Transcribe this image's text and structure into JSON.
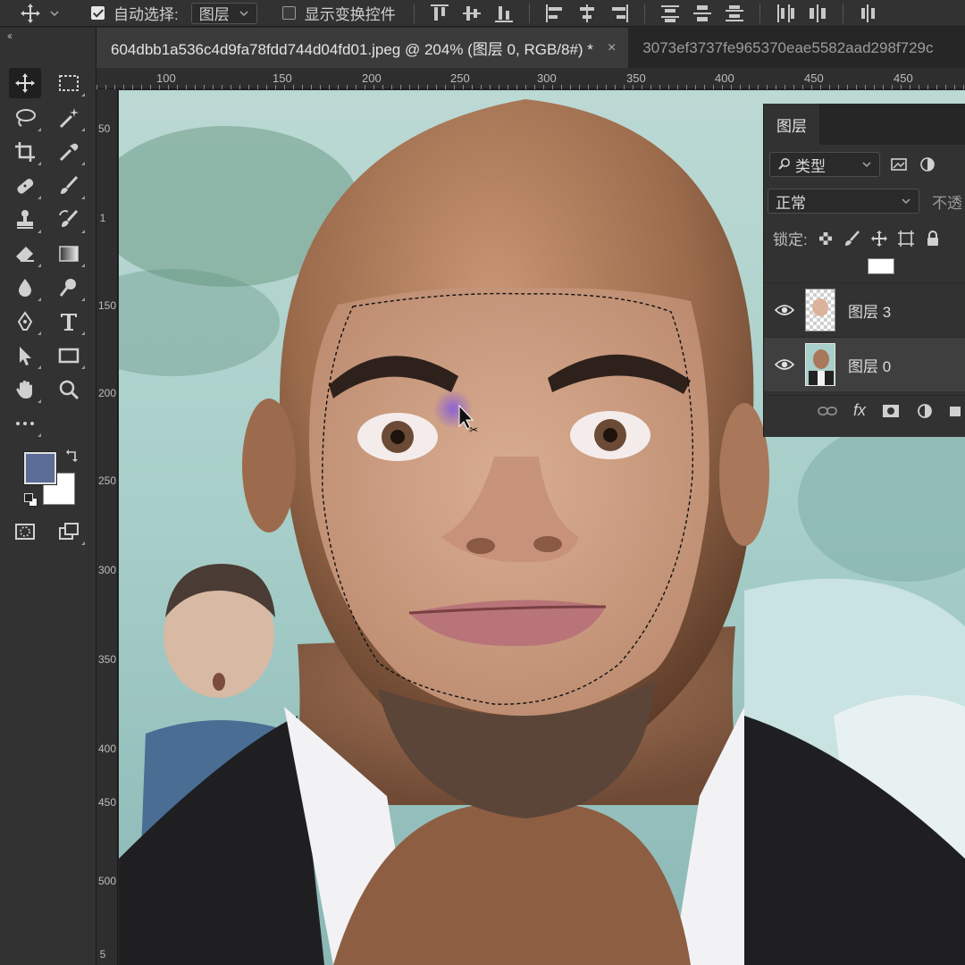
{
  "options_bar": {
    "auto_select_label": "自动选择:",
    "auto_select_checked": true,
    "auto_select_target": "图层",
    "show_transform_label": "显示变换控件",
    "show_transform_checked": false
  },
  "tabs": [
    {
      "label": "604dbb1a536c4d9fa78fdd744d04fd01.jpeg @ 204% (图层 0, RGB/8#) *",
      "close": "×",
      "active": true
    },
    {
      "label": "3073ef3737fe965370eae5582aad298f729c",
      "active": false
    }
  ],
  "toolbar": {
    "collapse": "‹‹",
    "foreground_color": "#5b6d96",
    "background_color": "#ffffff",
    "tools": [
      {
        "name": "move-tool",
        "icon": "move-icon"
      },
      {
        "name": "marquee-tool",
        "icon": "rect-marquee-icon"
      },
      {
        "name": "lasso-tool",
        "icon": "lasso-icon"
      },
      {
        "name": "magic-wand-tool",
        "icon": "magic-wand-icon"
      },
      {
        "name": "crop-tool",
        "icon": "crop-icon"
      },
      {
        "name": "eyedropper-tool",
        "icon": "eyedropper-icon"
      },
      {
        "name": "healing-brush-tool",
        "icon": "bandage-icon"
      },
      {
        "name": "brush-tool",
        "icon": "brush-icon"
      },
      {
        "name": "stamp-tool",
        "icon": "stamp-icon"
      },
      {
        "name": "history-brush-tool",
        "icon": "history-brush-icon"
      },
      {
        "name": "eraser-tool",
        "icon": "eraser-icon"
      },
      {
        "name": "gradient-tool",
        "icon": "gradient-icon"
      },
      {
        "name": "blur-tool",
        "icon": "drop-icon"
      },
      {
        "name": "dodge-tool",
        "icon": "dodge-icon"
      },
      {
        "name": "pen-tool",
        "icon": "pen-icon"
      },
      {
        "name": "type-tool",
        "icon": "type-icon"
      },
      {
        "name": "path-select-tool",
        "icon": "arrow-icon"
      },
      {
        "name": "shape-tool",
        "icon": "rectangle-icon"
      },
      {
        "name": "hand-tool",
        "icon": "hand-icon"
      },
      {
        "name": "zoom-tool",
        "icon": "zoom-icon"
      },
      {
        "name": "more-tools",
        "icon": "ellipsis-icon"
      }
    ]
  },
  "rulers": {
    "horizontal": [
      "100",
      "150",
      "200",
      "250",
      "300",
      "350",
      "400",
      "450"
    ],
    "vertical": [
      "50",
      "1",
      "150",
      "200",
      "250",
      "300",
      "350",
      "400",
      "450",
      "500",
      "5"
    ]
  },
  "layers_panel": {
    "tab_label": "图层",
    "filter_label": "类型",
    "blend_mode": "正常",
    "opacity_label": "不透",
    "lock_label": "锁定:",
    "layers": [
      {
        "name": "图层 3",
        "visible": true,
        "selected": false
      },
      {
        "name": "图层 0",
        "visible": true,
        "selected": true
      }
    ],
    "footer_fx": "fx"
  }
}
